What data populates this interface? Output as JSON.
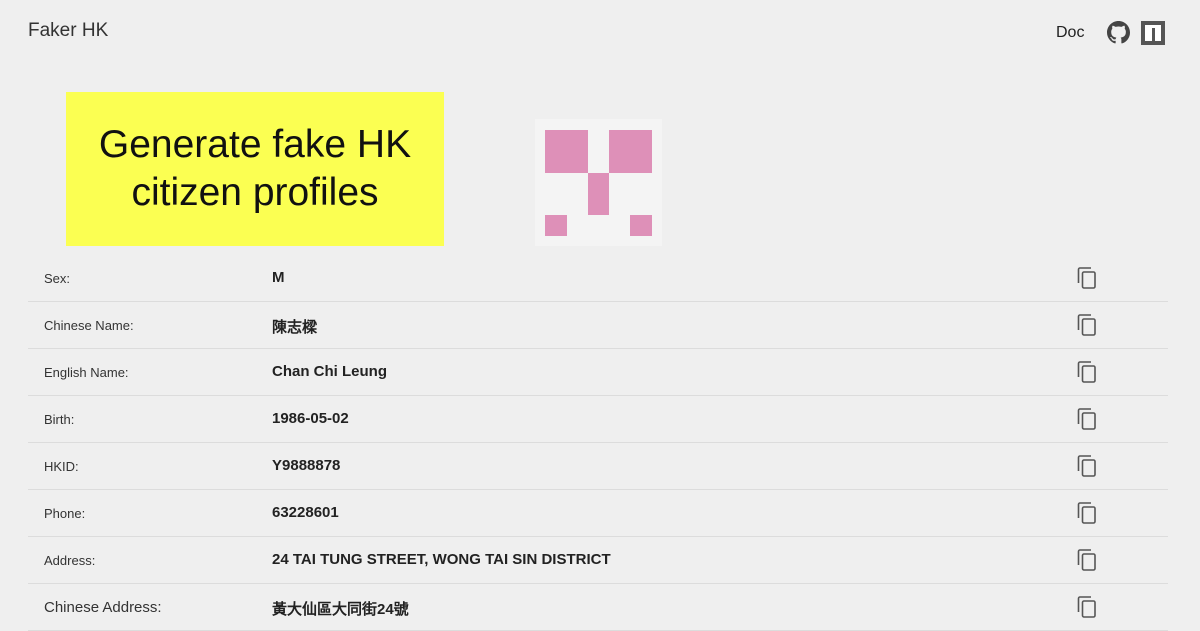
{
  "header": {
    "title": "Faker HK",
    "doc_label": "Doc",
    "icons": [
      "github-icon",
      "npm-icon"
    ]
  },
  "banner": {
    "line1": "Generate fake HK",
    "line2": "citizen profiles",
    "background": "#fbff52"
  },
  "avatar": {
    "color": "#de90b8"
  },
  "profile": {
    "rows": [
      {
        "label": "Sex:",
        "value": "M"
      },
      {
        "label": "Chinese Name:",
        "value": "陳志樑"
      },
      {
        "label": "English Name:",
        "value": "Chan Chi Leung"
      },
      {
        "label": "Birth:",
        "value": "1986-05-02"
      },
      {
        "label": "HKID:",
        "value": "Y9888878"
      },
      {
        "label": "Phone:",
        "value": "63228601"
      },
      {
        "label": "Address:",
        "value": "24 TAI TUNG STREET, WONG TAI SIN DISTRICT"
      },
      {
        "label": "Chinese Address:",
        "value": "黃大仙區大同街24號"
      }
    ],
    "copy_icon": "copy-icon"
  }
}
